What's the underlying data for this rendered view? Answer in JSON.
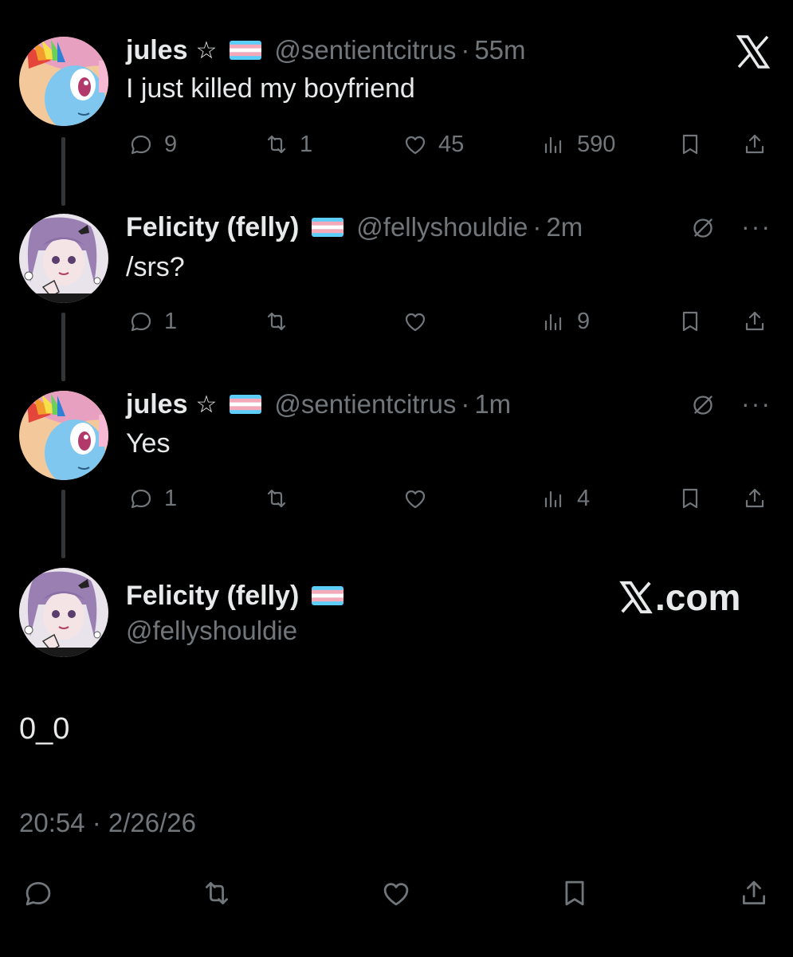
{
  "colors": {
    "background": "#000000",
    "text": "#e7e9ea",
    "muted": "#71767b",
    "line": "#333639"
  },
  "tweets": [
    {
      "name": "jules",
      "star": "☆",
      "handle": "@sentientcitrus",
      "sep": "·",
      "time": "55m",
      "text": "I just killed my boyfriend",
      "replies": "9",
      "reposts": "1",
      "likes": "45",
      "views": "590",
      "corner_icon": "x-logo-icon"
    },
    {
      "name": "Felicity (felly)",
      "handle": "@fellyshouldie",
      "sep": "·",
      "time": "2m",
      "text": "/srs?",
      "replies": "1",
      "reposts": "",
      "likes": "",
      "views": "9",
      "more": "···"
    },
    {
      "name": "jules",
      "star": "☆",
      "handle": "@sentientcitrus",
      "sep": "·",
      "time": "1m",
      "text": "Yes",
      "replies": "1",
      "reposts": "",
      "likes": "",
      "views": "4",
      "more": "···"
    }
  ],
  "main_tweet": {
    "name": "Felicity (felly)",
    "handle": "@fellyshouldie",
    "text": "0_0",
    "timestamp": "20:54 · 2/26/26",
    "wordmark": ".com"
  }
}
